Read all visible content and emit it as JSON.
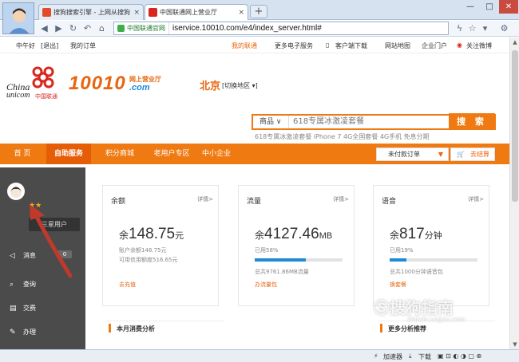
{
  "browser": {
    "tabs": [
      {
        "label": "搜狗搜索引擎 - 上网从搜狗",
        "icon": "sogou-icon"
      },
      {
        "label": "中国联通网上营业厅",
        "icon": "unicom-icon"
      }
    ],
    "new_tab": "+",
    "address_site": "中国联通官网",
    "url": "iservice.10010.com/e4/index_server.html#"
  },
  "topbar": {
    "greeting": "中午好",
    "logout": "[退出]",
    "my_orders": "我的订单",
    "my_unicom": "我的联通",
    "e_services": "更多电子服务",
    "client_download": "客户端下载",
    "site_map": "网站地图",
    "enterprise": "企业门户",
    "weibo": "关注微博"
  },
  "header": {
    "brand_en1": "China",
    "brand_en2": "unicom",
    "brand_cn": "中国联通",
    "hotline": "10010",
    "hotline_sub": "网上营业厅",
    "hotline_dotcom": ".com",
    "city": "北京",
    "city_switch": "[切换地区 ▾]"
  },
  "search": {
    "category": "商品 ∨",
    "placeholder": "618专属冰激凌套餐",
    "button": "搜 索",
    "hot": "618专属冰激凌套餐  iPhone 7  4G全国套餐  4G手机  免息分期"
  },
  "nav": {
    "home": "首  页",
    "self_service": "自助服务",
    "points_mall": "积分商城",
    "senior": "老用户专区",
    "sme": "中小企业",
    "unpaid_orders": "未付款订单",
    "checkout": "去结算"
  },
  "sidebar": {
    "user_level": "三星用户",
    "stars": "★★",
    "items": [
      {
        "label": "消息",
        "icon": "message-icon",
        "count": "0"
      },
      {
        "label": "查询",
        "icon": "search-icon"
      },
      {
        "label": "交费",
        "icon": "bill-icon"
      },
      {
        "label": "办理",
        "icon": "edit-icon"
      }
    ]
  },
  "cards": {
    "balance": {
      "title": "余额",
      "detail": "详情>",
      "prefix": "余",
      "value": "148.75",
      "unit": "元",
      "line1": "账户余额148.75元",
      "line2": "可用信用额度516.65元",
      "link": "去充值"
    },
    "flow": {
      "title": "流量",
      "detail": "详情>",
      "prefix": "余",
      "value": "4127.46",
      "unit": "MB",
      "used": "已用58%",
      "used_fraction": 0.58,
      "total": "总共9761.86MB流量",
      "link": "办流量包"
    },
    "voice": {
      "title": "语音",
      "detail": "详情>",
      "prefix": "余",
      "value": "817",
      "unit": "分钟",
      "used": "已用19%",
      "used_fraction": 0.19,
      "total": "总共1000分钟语音包",
      "link": "换套餐"
    }
  },
  "sections": {
    "monthly": "本月消费分析",
    "more": "更多分析推荐"
  },
  "statusbar": {
    "accelerator": "加速器",
    "download": "下载"
  },
  "watermark": {
    "text": "搜狗指南",
    "sub": "zhinan.sogou.com"
  },
  "colors": {
    "accent": "#f07a12",
    "active_nav": "#e65d07",
    "sidebar_bg": "#4b4b4b",
    "progress": "#1d8ad8",
    "annotation_arrow": "#c0392b"
  }
}
